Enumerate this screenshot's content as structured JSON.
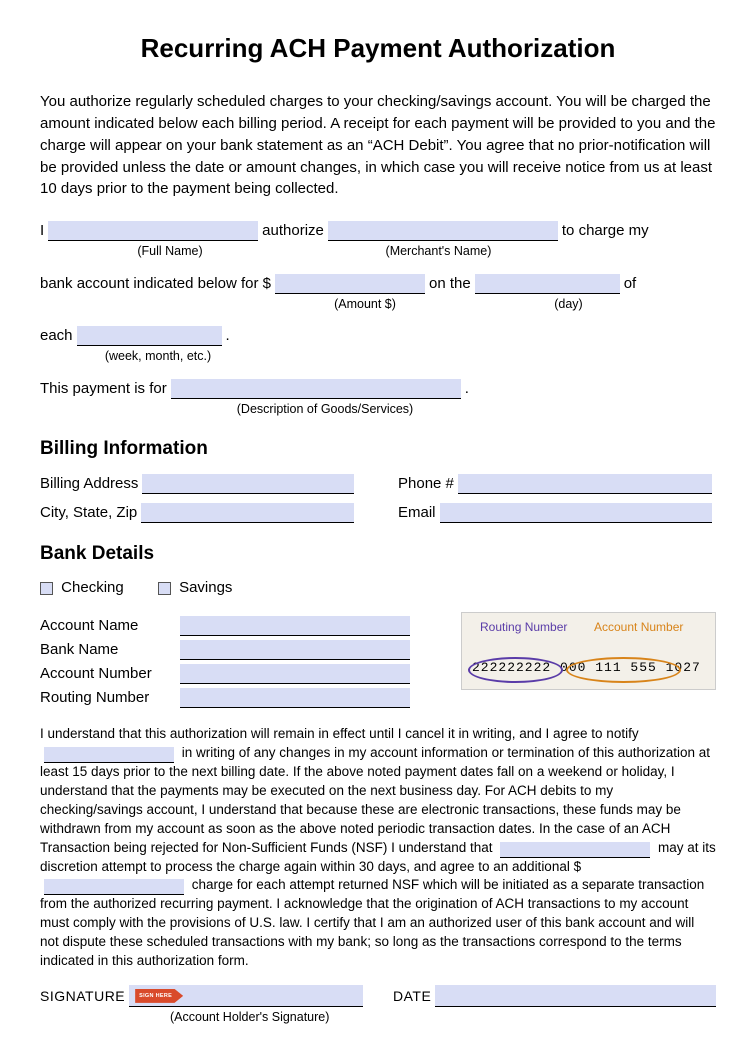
{
  "title": "Recurring ACH Payment Authorization",
  "intro": "You authorize regularly scheduled charges to your checking/savings account. You will be charged the amount indicated below each billing period. A receipt for each payment will be provided to you and the charge will appear on your bank statement as an “ACH Debit”. You agree that no prior-notification will be provided unless the date or amount changes, in which case you will receive notice from us at least 10 days prior to the payment being collected.",
  "auth": {
    "i": "I",
    "authorize": "authorize",
    "to_charge_my": "to charge my",
    "full_name_caption": "(Full Name)",
    "merchant_caption": "(Merchant's Name)",
    "bank_account_text": "bank account indicated below for $",
    "on_the": "on the",
    "of": "of",
    "amount_caption": "(Amount $)",
    "day_caption": "(day)",
    "each": "each",
    "period_caption": "(week, month, etc.)",
    "this_payment_is_for": "This payment is for",
    "description_caption": "(Description of Goods/Services)"
  },
  "billing": {
    "heading": "Billing Information",
    "address_label": "Billing Address",
    "phone_label": "Phone #",
    "city_label": "City, State, Zip",
    "email_label": "Email"
  },
  "bank": {
    "heading": "Bank Details",
    "checking": "Checking",
    "savings": "Savings",
    "account_name": "Account Name",
    "bank_name": "Bank Name",
    "account_number": "Account Number",
    "routing_number": "Routing Number",
    "check_rn_label": "Routing Number",
    "check_an_label": "Account Number",
    "check_numbers": "222222222  000 111 555   1027"
  },
  "terms": {
    "p1a": "I understand that this authorization will remain in effect until I cancel it in writing, and I agree to notify",
    "p1b": "in writing of any changes in my account information or termination of this authorization at least 15 days prior to the next billing date. If the above noted payment dates fall on a weekend or holiday, I understand that the payments may be executed on the next business day. For ACH debits to my checking/savings account, I understand that because these are electronic transactions, these funds may be withdrawn from my account as soon as the above noted periodic transaction dates. In the case of an ACH Transaction being rejected for Non-Sufficient Funds (NSF) I understand that",
    "p1c": "may at its discretion attempt to process the charge again within 30 days, and agree to an additional $",
    "p1d": "charge for each attempt returned NSF which will be initiated as a separate transaction from the authorized recurring payment. I acknowledge that the origination of ACH transactions to my account must comply with the provisions of U.S. law. I certify that I am an authorized user of this bank account and will not dispute these scheduled transactions with my bank; so long as the transactions correspond to the terms indicated in this authorization form."
  },
  "sig": {
    "signature": "SIGNATURE",
    "date": "DATE",
    "sign_here": "SIGN HERE",
    "caption": "(Account Holder's Signature)"
  }
}
